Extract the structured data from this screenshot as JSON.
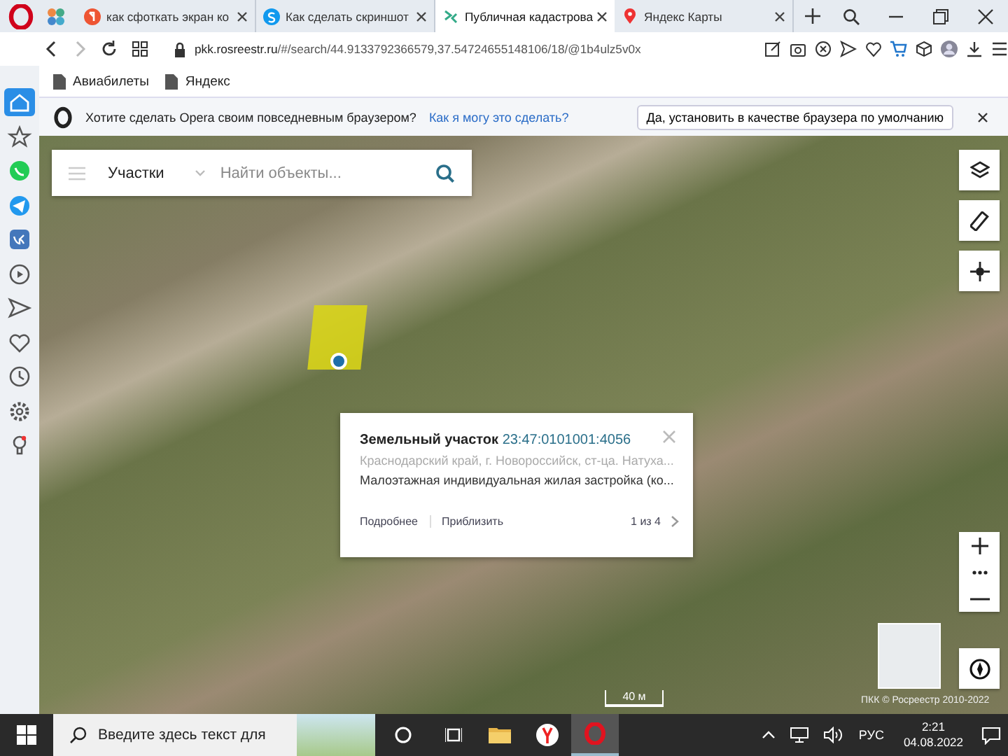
{
  "tabs": [
    {
      "title": "как сфоткать экран ко",
      "selected": false,
      "kind": "yandex"
    },
    {
      "title": "Как сделать скриншот",
      "selected": false,
      "kind": "skype"
    },
    {
      "title": "Публичная кадастрова",
      "selected": true,
      "kind": "pkk"
    },
    {
      "title": "Яндекс Карты",
      "selected": false,
      "kind": "maps"
    }
  ],
  "address": {
    "host": "pkk.rosreestr.ru",
    "path": "/#/search/44.9133792366579,37.54724655148106/18/@1b4ulz5v0x"
  },
  "bookmarks": [
    {
      "label": "Авиабилеты"
    },
    {
      "label": "Яндекс"
    }
  ],
  "sidebar": [
    {
      "kind": "home",
      "selected": true
    },
    {
      "kind": "star",
      "selected": false
    },
    {
      "kind": "whatsapp",
      "selected": false
    },
    {
      "kind": "telegram",
      "selected": false
    },
    {
      "kind": "vk",
      "selected": false
    },
    {
      "kind": "player",
      "selected": false
    },
    {
      "kind": "send",
      "selected": false
    },
    {
      "kind": "heart",
      "selected": false
    },
    {
      "kind": "clock",
      "selected": false
    },
    {
      "kind": "settings",
      "selected": false
    },
    {
      "kind": "bulb",
      "selected": false
    }
  ],
  "offer": {
    "text": "Хотите сделать Opera своим повседневным браузером?",
    "link": "Как я могу это сделать?",
    "button": "Да, установить в качестве браузера по умолчанию"
  },
  "search": {
    "layer": "Участки",
    "placeholder": "Найти объекты..."
  },
  "popup": {
    "type": "Земельный участок",
    "number": "23:47:0101001:4056",
    "address": "Краснодарский край, г. Новороссийск, ст-ца. Натуха...",
    "use": "Малоэтажная индивидуальная жилая застройка (ко...",
    "links": [
      "Подробнее",
      "Приблизить"
    ],
    "pager": "1 из 4"
  },
  "map": {
    "scale": "40 м",
    "attribution": "ПКК © Росреестр 2010-2022"
  },
  "taskbar": {
    "search_placeholder": "Введите здесь текст для",
    "apps": [
      {
        "kind": "folder",
        "selected": false
      },
      {
        "kind": "yandex",
        "selected": false
      },
      {
        "kind": "opera",
        "selected": true
      }
    ],
    "language": "РУС",
    "time": "2:21",
    "date": "04.08.2022"
  }
}
